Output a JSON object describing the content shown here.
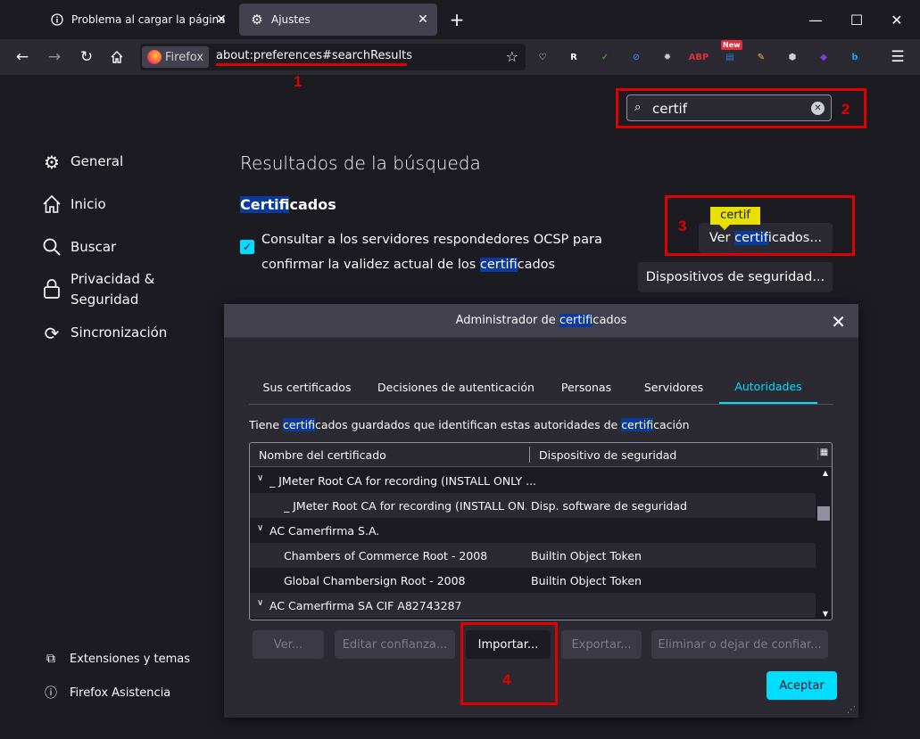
{
  "tabs": [
    {
      "title": "Problema al cargar la página",
      "icon": "info-icon"
    },
    {
      "title": "Ajustes",
      "icon": "gear-icon"
    }
  ],
  "new_tab_label": "+",
  "window_controls": {
    "minimize": "—",
    "maximize": "☐",
    "close": "✕"
  },
  "urlbar": {
    "identity_label": "Firefox",
    "url": "about:preferences#searchResults"
  },
  "extensions": [
    {
      "name": "pocket-icon",
      "glyph": "♡",
      "color": "#fbfbfe"
    },
    {
      "name": "r-extension-icon",
      "glyph": "R",
      "color": "#ffffff"
    },
    {
      "name": "shield-extension-icon",
      "glyph": "✓",
      "color": "#2ecc40"
    },
    {
      "name": "block-extension-icon",
      "glyph": "⊘",
      "color": "#3a7bd5"
    },
    {
      "name": "gear-extension-icon",
      "glyph": "✹",
      "color": "#cfcfd8"
    },
    {
      "name": "abp-icon",
      "glyph": "ABP",
      "color": "#e0303e"
    },
    {
      "name": "news-extension-icon",
      "glyph": "▤",
      "color": "#3a7bd5",
      "badge": "New"
    },
    {
      "name": "pencil-extension-icon",
      "glyph": "✎",
      "color": "#f0c040"
    },
    {
      "name": "cube-extension-icon",
      "glyph": "⬢",
      "color": "#cfcfd8"
    },
    {
      "name": "diamond-extension-icon",
      "glyph": "◆",
      "color": "#7b3fe4"
    },
    {
      "name": "bing-icon",
      "glyph": "b",
      "color": "#2a9df4"
    }
  ],
  "annotations": {
    "n1": "1",
    "n2": "2",
    "n3": "3",
    "n4": "4"
  },
  "search": {
    "value": "certif"
  },
  "sidebar": {
    "items": [
      {
        "label": "General",
        "icon": "gear-icon"
      },
      {
        "label": "Inicio",
        "icon": "home-icon"
      },
      {
        "label": "Buscar",
        "icon": "search-icon"
      },
      {
        "label": "Privacidad &",
        "label2": "Seguridad",
        "icon": "lock-icon"
      },
      {
        "label": "Sincronización",
        "icon": "sync-icon"
      }
    ],
    "footer": [
      {
        "label": "Extensiones y temas",
        "icon": "puzzle-icon"
      },
      {
        "label": "Firefox Asistencia",
        "icon": "help-icon"
      }
    ]
  },
  "main": {
    "results_title": "Resultados de la búsqueda",
    "cert_heading_hl": "Certif",
    "cert_heading_rest": "icados",
    "ocsp_part1": "Consultar a los servidores respondedores OCSP para confirmar la validez actual de los ",
    "ocsp_hl": "certif",
    "ocsp_part2": "icados",
    "tooltip": "certif",
    "view_certs_pre": "Ver ",
    "view_certs_hl": "certif",
    "view_certs_post": "icados...",
    "security_devices": "Dispositivos de seguridad..."
  },
  "dialog": {
    "title_pre": "Administrador de ",
    "title_hl": "certif",
    "title_post": "icados",
    "tabs": [
      "Sus certificados",
      "Decisiones de autenticación",
      "Personas",
      "Servidores",
      "Autoridades"
    ],
    "selected_tab": "Autoridades",
    "desc_pre": "Tiene ",
    "desc_hl1": "certif",
    "desc_mid": "icados guardados que identifican estas autoridades de ",
    "desc_hl2": "certif",
    "desc_post": "icación",
    "columns": [
      "Nombre del certificado",
      "Dispositivo de seguridad"
    ],
    "rows": [
      {
        "type": "group",
        "name": "_ JMeter Root CA for recording (INSTALL ONLY ...",
        "device": ""
      },
      {
        "type": "item",
        "name": "_ JMeter Root CA for recording (INSTALL ON...",
        "device": "Disp. software de seguridad"
      },
      {
        "type": "group",
        "name": "AC Camerfirma S.A.",
        "device": ""
      },
      {
        "type": "item",
        "name": "Chambers of Commerce Root - 2008",
        "device": "Builtin Object Token"
      },
      {
        "type": "item",
        "name": "Global Chambersign Root - 2008",
        "device": "Builtin Object Token"
      },
      {
        "type": "group",
        "name": "AC Camerfirma SA CIF A82743287",
        "device": ""
      }
    ],
    "buttons": [
      {
        "label": "Ver...",
        "enabled": false
      },
      {
        "label": "Editar confianza...",
        "enabled": false
      },
      {
        "label": "Importar...",
        "enabled": true
      },
      {
        "label": "Exportar...",
        "enabled": false
      },
      {
        "label": "Eliminar o dejar de confiar...",
        "enabled": false
      }
    ],
    "accept": "Aceptar"
  }
}
